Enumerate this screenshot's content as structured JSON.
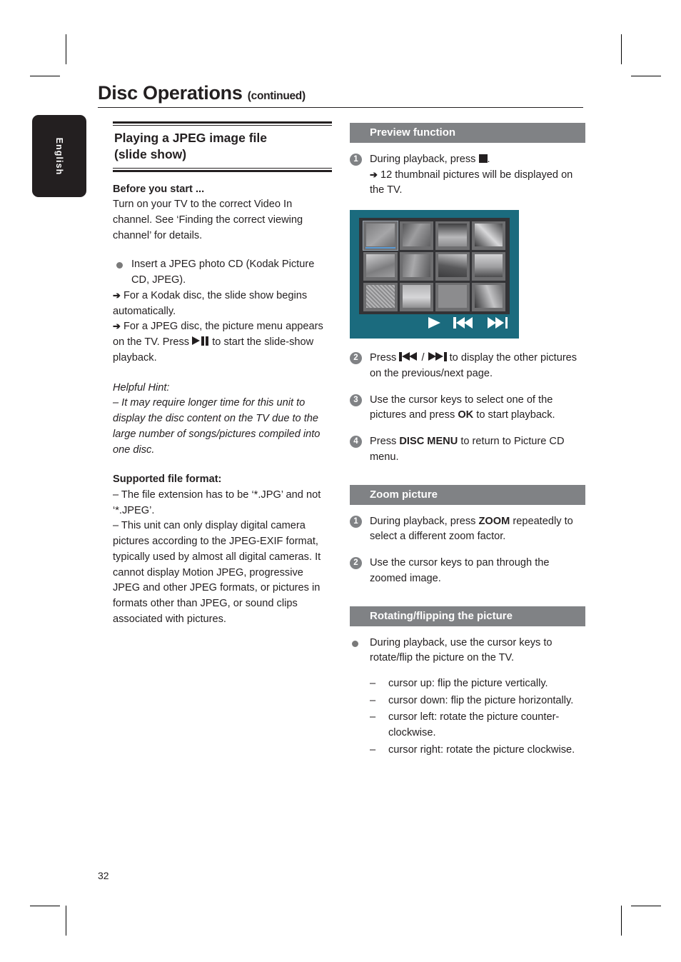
{
  "page": {
    "chapter_title": "Disc Operations",
    "chapter_title_suffix": "(continued)",
    "language_tab": "English",
    "page_number": "32"
  },
  "left_column": {
    "heading_line1": "Playing a JPEG image file",
    "heading_line2": "(slide show)",
    "before_you_start": {
      "label": "Before you start ...",
      "text": "Turn on your TV to the correct Video In channel.  See ‘Finding the correct viewing channel’ for details."
    },
    "insert_bullet": {
      "text": "Insert a JPEG photo CD (Kodak Picture CD, JPEG).",
      "arrow1": "For a Kodak disc, the slide show begins automatically.",
      "arrow2_before": "For a JPEG disc, the picture menu appears on the TV.  Press",
      "arrow2_after": "to start the slide-show playback."
    },
    "helpful_hint": {
      "label": "Helpful Hint:",
      "text": "–  It may require longer time for this unit to display the disc content on the TV due to the large number of songs/pictures compiled into one disc."
    },
    "supported_format": {
      "label": "Supported file format:",
      "item1": "–   The file extension has to be ‘*.JPG’ and not ‘*.JPEG’.",
      "item2": "–  This unit can only display digital camera pictures according to the JPEG-EXIF format, typically used by almost all digital cameras.  It cannot display Motion JPEG, progressive JPEG and other JPEG formats, or pictures in formats other than JPEG, or sound clips associated with pictures."
    }
  },
  "right_column": {
    "preview": {
      "header": "Preview function",
      "step1_before": "During playback, press",
      "step1_after": ".",
      "step1_arrow": "12 thumbnail pictures will be displayed on the TV.",
      "step2_before": "Press",
      "step2_sep": "/",
      "step2_after": "to display the other pictures on the previous/next page.",
      "step3_before": "Use the cursor keys to select one of the pictures and press",
      "step3_bold": "OK",
      "step3_after": "to start playback.",
      "step4_before": "Press",
      "step4_bold": "DISC MENU",
      "step4_after": "to return to Picture CD menu."
    },
    "tv_figure": {
      "thumbnail_count": 12,
      "rows": 3,
      "columns": 4,
      "selected_index": 0,
      "border_color": "#1b6b7e",
      "background_color": "#333336",
      "selection_color": "#5b9bd5",
      "control_icons": [
        "play-icon",
        "previous-icon",
        "next-icon"
      ]
    },
    "zoom_picture": {
      "header": "Zoom picture",
      "step1_before": "During playback, press",
      "step1_bold": "ZOOM",
      "step1_after": "repeatedly to select a different zoom factor.",
      "step2": "Use the cursor keys to pan through the zoomed image."
    },
    "rotating": {
      "header": "Rotating/flipping the picture",
      "bullet": "During playback, use the cursor keys to rotate/flip the picture on the TV.",
      "items": [
        "cursor up: flip the picture vertically.",
        "cursor down: flip the picture horizontally.",
        "cursor left: rotate the picture counter-clockwise.",
        "cursor right: rotate the picture clockwise."
      ]
    }
  }
}
